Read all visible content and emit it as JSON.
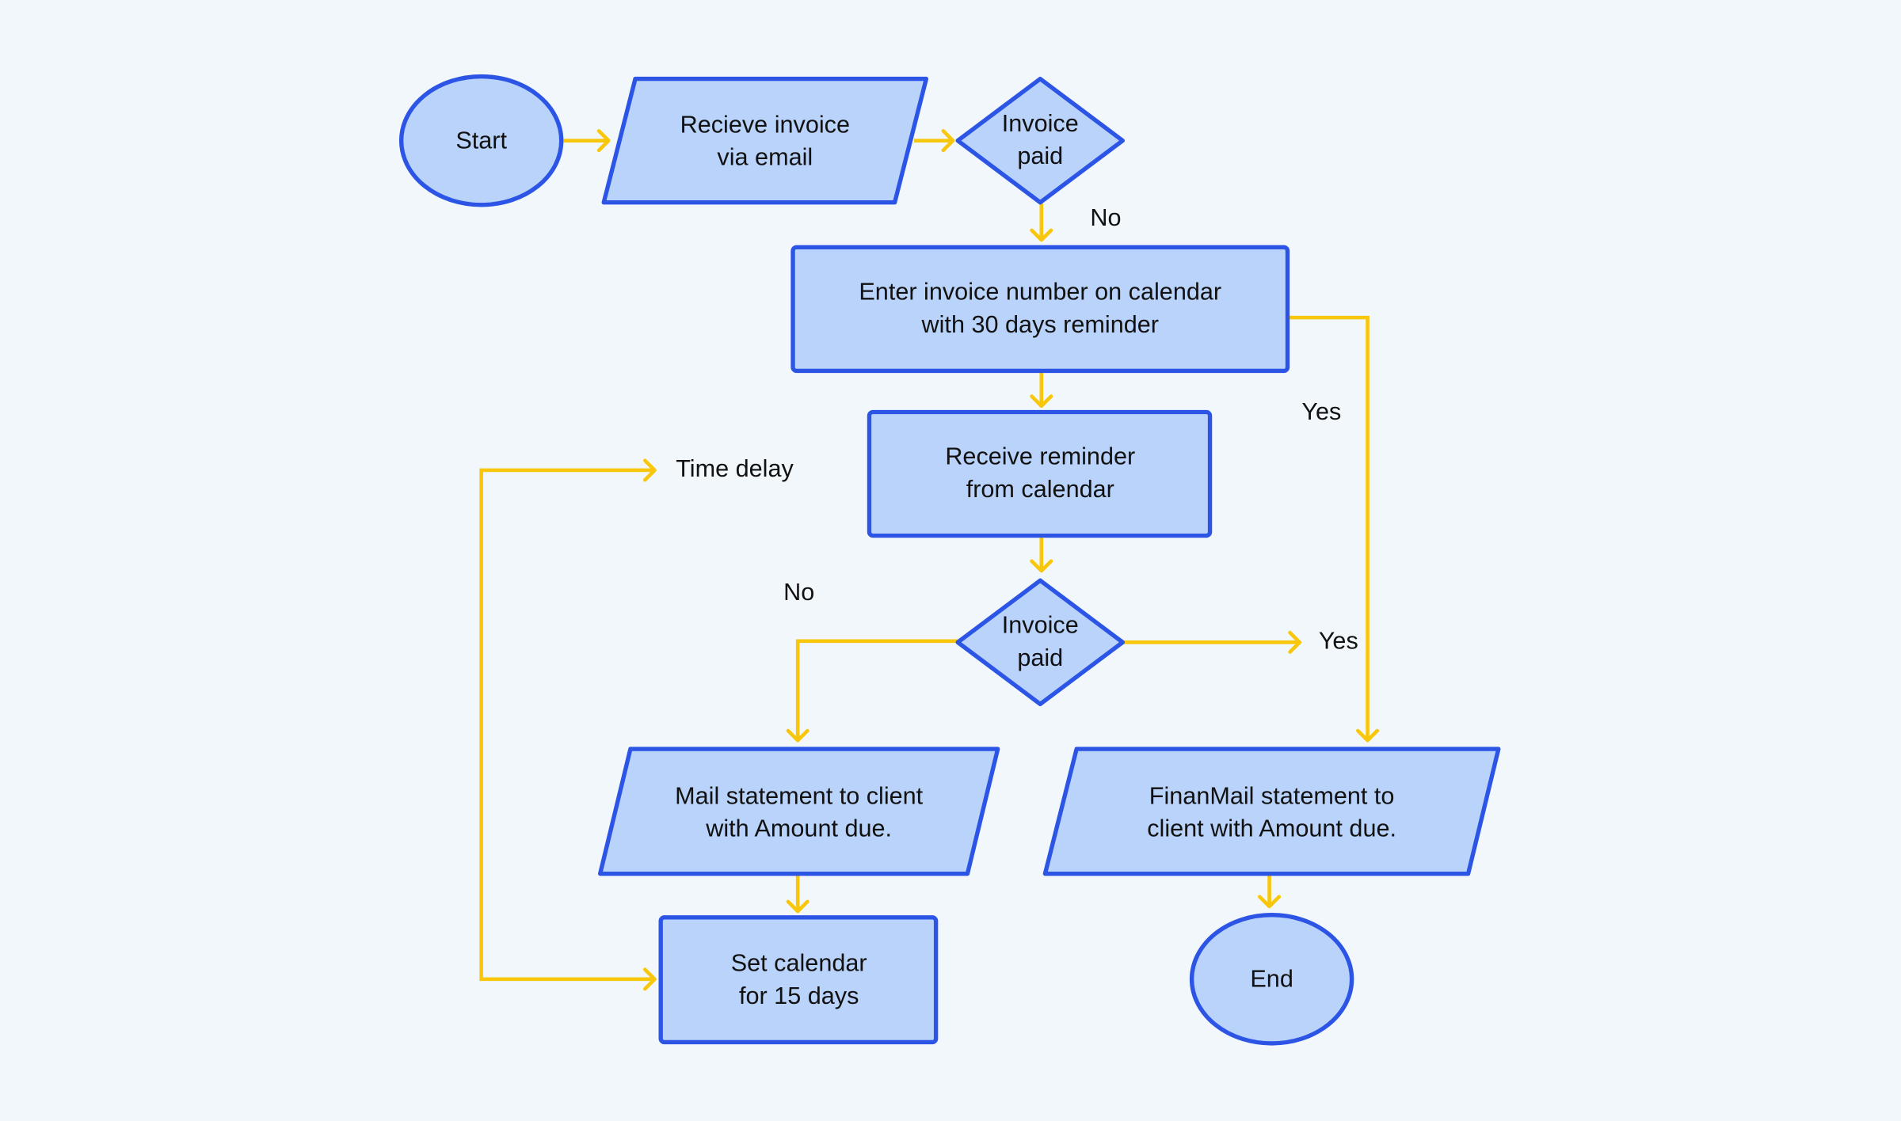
{
  "colors": {
    "background": "#f2f7fb",
    "node_fill": "#b9d3fb",
    "node_stroke": "#2c55e6",
    "connector": "#f8c70c"
  },
  "nodes": {
    "start": {
      "shape": "terminator",
      "lines": [
        "Start"
      ]
    },
    "receive_invoice": {
      "shape": "parallelogram",
      "lines": [
        "Recieve invoice",
        "via email"
      ]
    },
    "invoice_paid_1": {
      "shape": "diamond",
      "lines": [
        "Invoice",
        "paid"
      ]
    },
    "enter_invoice": {
      "shape": "rectangle",
      "lines": [
        "Enter invoice number on calendar",
        "with 30 days reminder"
      ]
    },
    "receive_reminder": {
      "shape": "rectangle",
      "lines": [
        "Receive reminder",
        "from calendar"
      ]
    },
    "invoice_paid_2": {
      "shape": "diamond",
      "lines": [
        "Invoice",
        "paid"
      ]
    },
    "mail_statement": {
      "shape": "parallelogram",
      "lines": [
        "Mail statement to client",
        "with Amount due."
      ]
    },
    "finan_mail": {
      "shape": "parallelogram",
      "lines": [
        "FinanMail statement to",
        "client with Amount due."
      ]
    },
    "set_calendar": {
      "shape": "rectangle",
      "lines": [
        "Set calendar",
        "for 15 days"
      ]
    },
    "end": {
      "shape": "terminator",
      "lines": [
        "End"
      ]
    }
  },
  "edge_labels": {
    "no_1": "No",
    "yes_1": "Yes",
    "time_delay": "Time delay",
    "no_2": "No",
    "yes_2": "Yes"
  }
}
